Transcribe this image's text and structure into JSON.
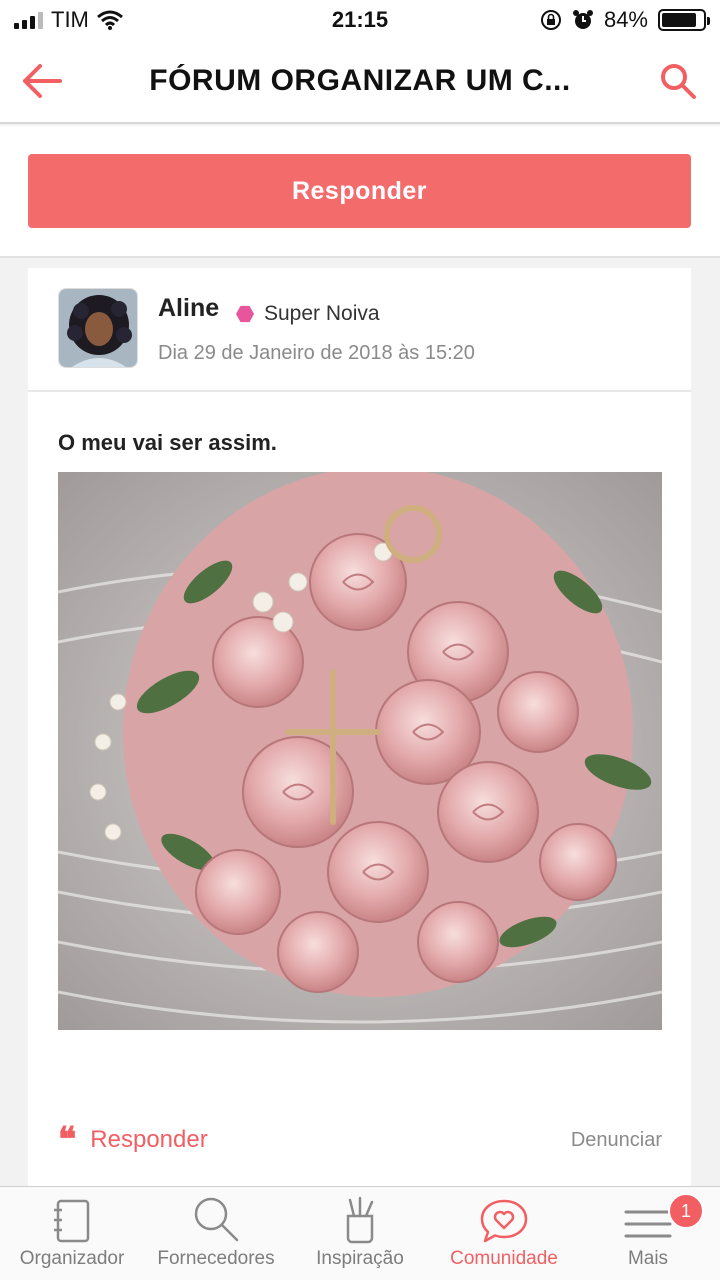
{
  "status_bar": {
    "carrier": "TIM",
    "time": "21:15",
    "battery": "84%",
    "battery_level": 0.84
  },
  "header": {
    "title": "FÓRUM ORGANIZAR UM C...",
    "back_icon": "arrow-left-icon",
    "search_icon": "search-icon"
  },
  "reply_button": {
    "label": "Responder"
  },
  "post": {
    "author_name": "Aline",
    "author_badge": "Super Noiva",
    "date": "Dia 29 de Janeiro de 2018 às 15:20",
    "text": "O meu vai ser assim.",
    "reply_label": "Responder",
    "report_label": "Denunciar"
  },
  "tab_bar": {
    "items": [
      {
        "label": "Organizador",
        "icon": "notebook-icon"
      },
      {
        "label": "Fornecedores",
        "icon": "magnifier-icon"
      },
      {
        "label": "Inspiração",
        "icon": "brush-cup-icon"
      },
      {
        "label": "Comunidade",
        "icon": "chat-heart-icon"
      },
      {
        "label": "Mais",
        "icon": "menu-icon"
      }
    ],
    "notification_count": "1"
  },
  "colors": {
    "accent": "#f46b6c",
    "badge": "#e8559c",
    "muted": "#8a8a8a"
  }
}
